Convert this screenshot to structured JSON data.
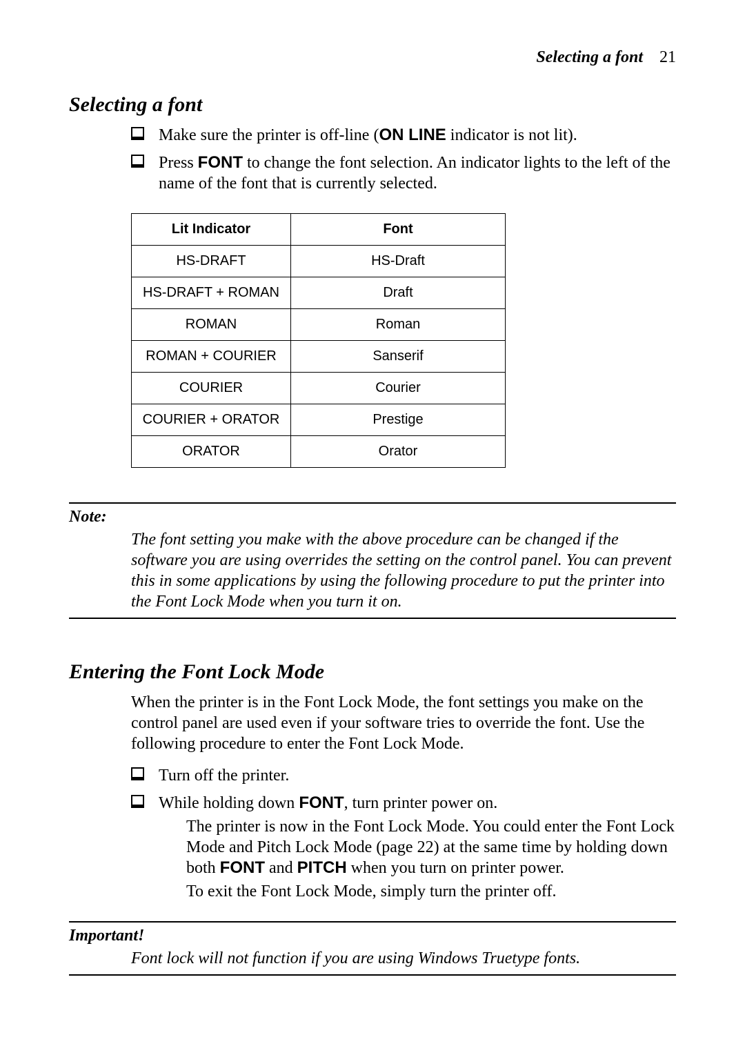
{
  "running_head": {
    "title": "Selecting a font",
    "page": "21"
  },
  "section1": {
    "heading": "Selecting a font",
    "bullets": [
      {
        "pre": "Make sure the printer is off-line (",
        "bold": "ON LINE",
        "post": " indicator is not lit)."
      },
      {
        "pre": "Press ",
        "bold": "FONT",
        "post": " to change the font selection. An indicator lights to the left of the name of the font that is currently selected."
      }
    ],
    "table": {
      "headers": [
        "Lit Indicator",
        "Font"
      ],
      "rows": [
        [
          "HS-DRAFT",
          "HS-Draft"
        ],
        [
          "HS-DRAFT + ROMAN",
          "Draft"
        ],
        [
          "ROMAN",
          "Roman"
        ],
        [
          "ROMAN + COURIER",
          "Sanserif"
        ],
        [
          "COURIER",
          "Courier"
        ],
        [
          "COURIER + ORATOR",
          "Prestige"
        ],
        [
          "ORATOR",
          "Orator"
        ]
      ]
    }
  },
  "note": {
    "head": "Note:",
    "body": "The font setting you make with the above procedure can be changed if the software you are using overrides the setting on the control panel. You can prevent this in some applications by using the following procedure to put the printer into the Font Lock Mode when you turn it on."
  },
  "section2": {
    "heading": "Entering the Font Lock Mode",
    "intro": "When the printer is in the Font Lock Mode, the font settings you make on the control panel are used even if your software tries to override the font. Use the following procedure to enter the Font Lock Mode.",
    "bullets": [
      {
        "pre": "Turn off the printer.",
        "bold": "",
        "post": ""
      },
      {
        "pre": "While holding down ",
        "bold": "FONT",
        "post": ", turn printer power on."
      }
    ],
    "after": {
      "p1_pre": "The printer is now in the Font Lock Mode. You could enter the Font Lock Mode and Pitch Lock Mode (page 22) at the same time by holding down both ",
      "p1_b1": "FONT",
      "p1_mid": " and ",
      "p1_b2": "PITCH",
      "p1_post": " when you turn on printer power.",
      "p2": "To exit the Font Lock Mode, simply turn the printer off."
    }
  },
  "important": {
    "head": "Important!",
    "body": "Font lock will not function if you are using Windows Truetype fonts."
  }
}
